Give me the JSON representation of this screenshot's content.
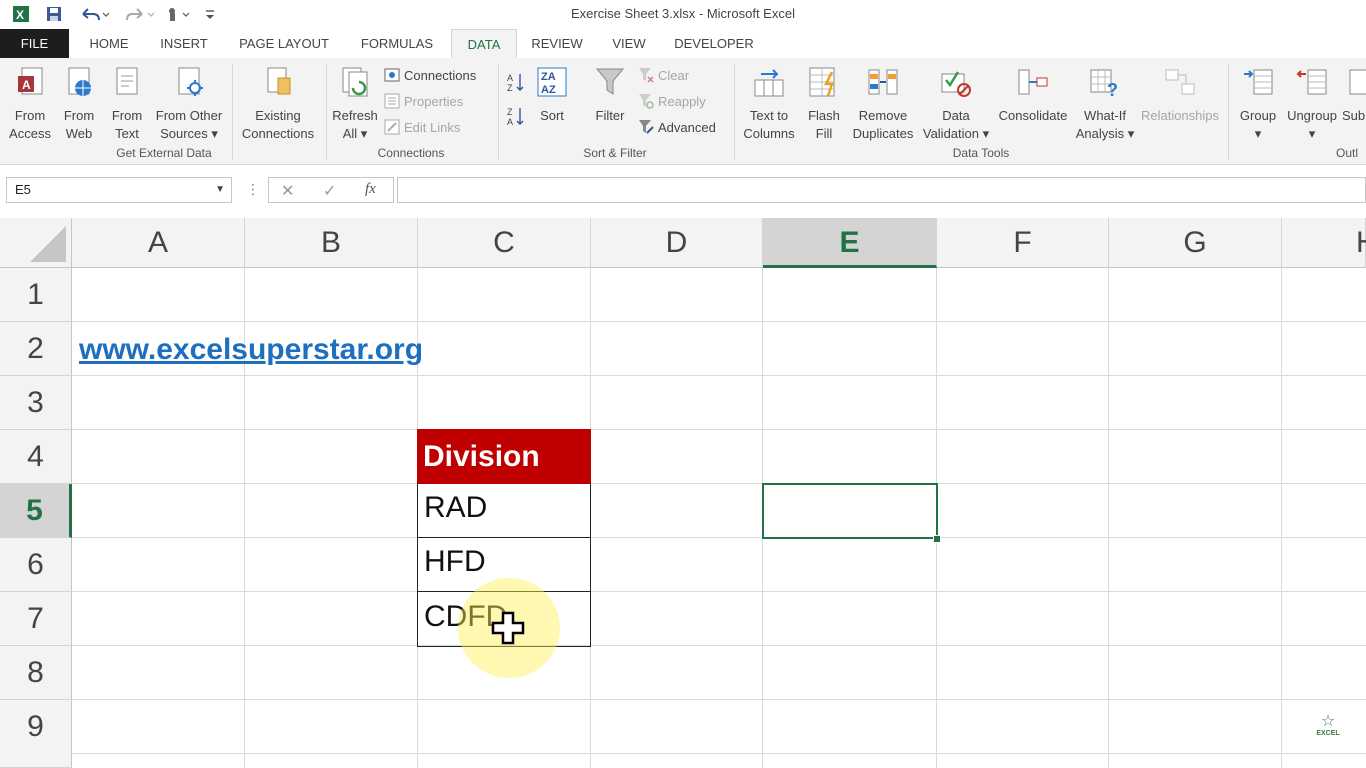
{
  "window": {
    "title": "Exercise Sheet 3.xlsx - Microsoft Excel"
  },
  "tabs": [
    {
      "label": "FILE"
    },
    {
      "label": "HOME"
    },
    {
      "label": "INSERT"
    },
    {
      "label": "PAGE LAYOUT"
    },
    {
      "label": "FORMULAS"
    },
    {
      "label": "DATA"
    },
    {
      "label": "REVIEW"
    },
    {
      "label": "VIEW"
    },
    {
      "label": "DEVELOPER"
    }
  ],
  "ribbon": {
    "get_external": {
      "from_access": {
        "l1": "From",
        "l2": "Access"
      },
      "from_web": {
        "l1": "From",
        "l2": "Web"
      },
      "from_text": {
        "l1": "From",
        "l2": "Text"
      },
      "from_other": {
        "l1": "From Other",
        "l2": "Sources ▾"
      },
      "existing": {
        "l1": "Existing",
        "l2": "Connections"
      },
      "group_label": "Get External Data"
    },
    "connections": {
      "refresh": {
        "l1": "Refresh",
        "l2": "All ▾"
      },
      "connections": "Connections",
      "properties": "Properties",
      "edit_links": "Edit Links",
      "group_label": "Connections"
    },
    "sort_filter": {
      "sort": "Sort",
      "filter": "Filter",
      "clear": "Clear",
      "reapply": "Reapply",
      "advanced": "Advanced",
      "group_label": "Sort & Filter"
    },
    "data_tools": {
      "text_to_columns": {
        "l1": "Text to",
        "l2": "Columns"
      },
      "flash_fill": {
        "l1": "Flash",
        "l2": "Fill"
      },
      "remove_duplicates": {
        "l1": "Remove",
        "l2": "Duplicates"
      },
      "data_validation": {
        "l1": "Data",
        "l2": "Validation ▾"
      },
      "consolidate": "Consolidate",
      "what_if": {
        "l1": "What-If",
        "l2": "Analysis ▾"
      },
      "relationships": "Relationships",
      "group_label": "Data Tools"
    },
    "outline": {
      "group": "Group",
      "ungroup": "Ungroup",
      "subtotal": "Sub",
      "group_label": "Outl"
    }
  },
  "formula_bar": {
    "name_box": "E5",
    "formula": ""
  },
  "grid": {
    "columns": [
      "A",
      "B",
      "C",
      "D",
      "E",
      "F",
      "G",
      "H"
    ],
    "rows": [
      "1",
      "2",
      "3",
      "4",
      "5",
      "6",
      "7",
      "8",
      "9"
    ],
    "selected_cell": "E5",
    "cells": {
      "A2": "www.excelsuperstar.org",
      "C4": "Division",
      "C5": "RAD",
      "C6": "HFD",
      "C7": "CDFD"
    }
  },
  "colors": {
    "accent": "#217346",
    "header_fill": "#c00000",
    "link": "#1f6fbf"
  },
  "watermark": {
    "text": "EXCEL"
  }
}
